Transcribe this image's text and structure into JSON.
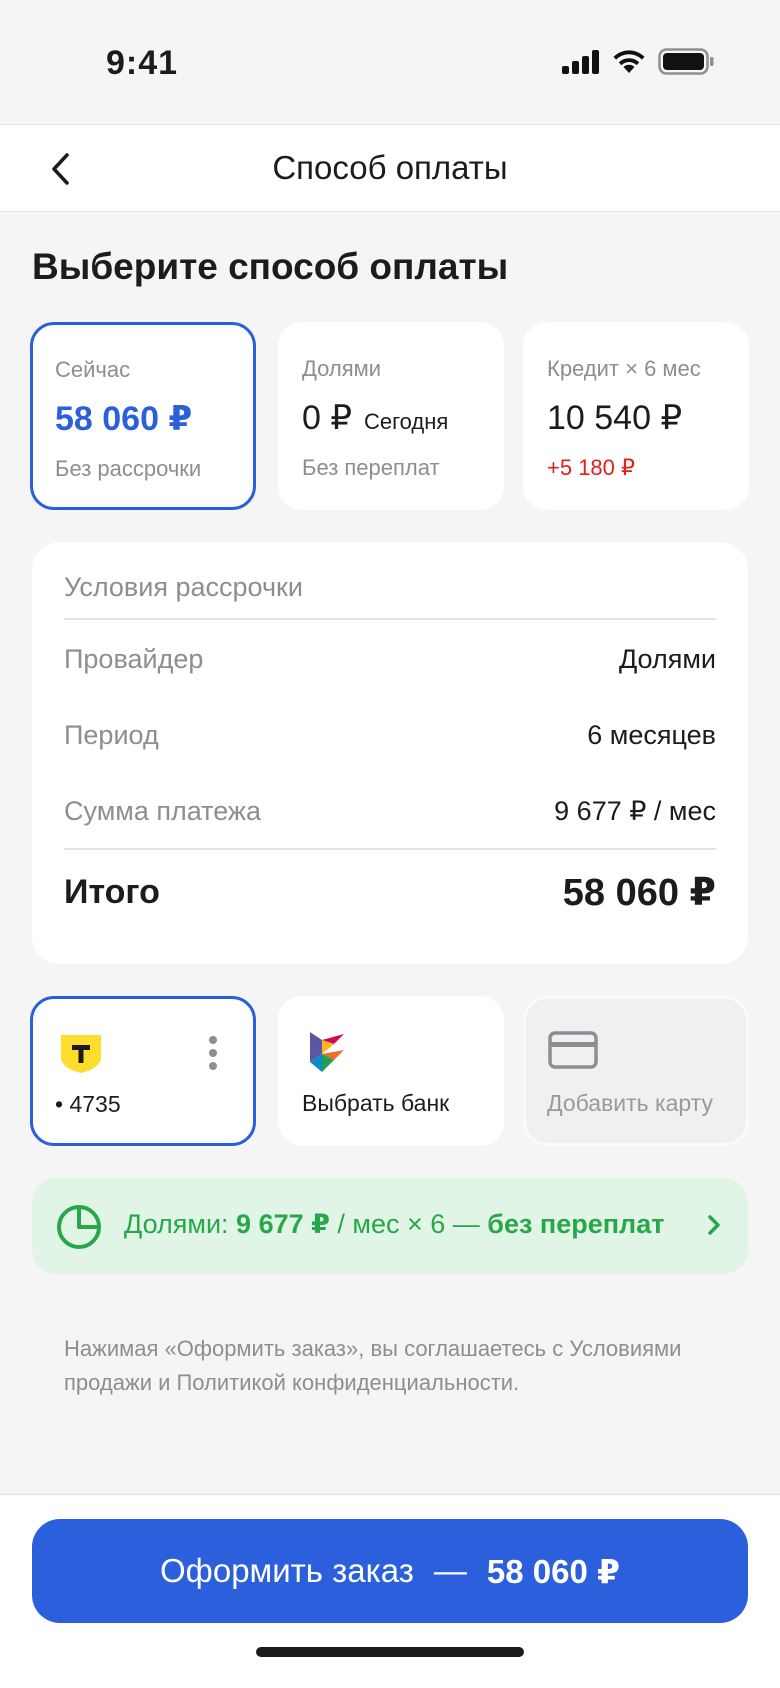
{
  "status": {
    "time": "9:41"
  },
  "nav": {
    "title": "Способ оплаты"
  },
  "heading": "Выберите способ оплаты",
  "methods": [
    {
      "label": "Сейчас",
      "amount": "58 060 ₽",
      "extra": "",
      "sub": "Без рассрочки",
      "selected": true
    },
    {
      "label": "Долями",
      "amount": "0 ₽",
      "extra": "Сегодня",
      "sub": "Без переплат",
      "selected": false
    },
    {
      "label": "Кредит × 6 мес",
      "amount": "10 540 ₽",
      "extra": "",
      "sub": "+5 180 ₽",
      "selected": false
    }
  ],
  "terms": {
    "title": "Условия рассрочки",
    "rows": [
      {
        "label": "Провайдер",
        "value": "Долями"
      },
      {
        "label": "Период",
        "value": "6 месяцев"
      },
      {
        "label": "Сумма платежа",
        "value": "9 677 ₽ / мес"
      }
    ],
    "total_label": "Итого",
    "total_value": "58 060 ₽"
  },
  "sources": [
    {
      "label": "• 4735",
      "icon": "tbank-logo-icon"
    },
    {
      "label": "Выбрать банк",
      "icon": "sbp-logo-icon"
    },
    {
      "label": "Добавить карту",
      "icon": "card-icon"
    }
  ],
  "promo": {
    "prefix": "Долями: ",
    "amount": "9 677 ₽",
    "suffix": " / мес × 6 — ",
    "highlight": "без переплат"
  },
  "legal": "Нажимая «Оформить заказ», вы соглашаетесь с Условиями продажи и Политикой конфиденциальности.",
  "cta": {
    "label": "Оформить заказ",
    "sep": "—",
    "total": "58 060 ₽"
  },
  "colors": {
    "accent": "#2b5fdb",
    "negative": "#e0201b",
    "promo_bg": "#e1f5e6",
    "promo_fg": "#28a74a"
  }
}
